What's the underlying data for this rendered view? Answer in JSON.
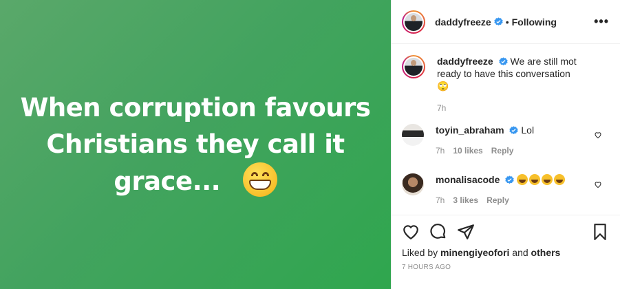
{
  "post": {
    "caption_line1": "When corruption favours",
    "caption_line2": "Christians they call it",
    "caption_line3": "grace...",
    "emoji_icon": "grinning-face-icon"
  },
  "header": {
    "username": "daddyfreeze",
    "dot": "•",
    "follow_status": "Following",
    "more_label": "•••"
  },
  "caption": {
    "username": "daddyfreeze",
    "text": "We are still mot ready to have this conversation 🙄",
    "time": "7h"
  },
  "comments": [
    {
      "username": "toyin_abraham",
      "text": "Lol",
      "time": "7h",
      "likes": "10 likes",
      "reply": "Reply"
    },
    {
      "username": "monalisacode",
      "text": "",
      "time": "7h",
      "likes": "3 likes",
      "reply": "Reply"
    }
  ],
  "footer": {
    "liked_by_prefix": "Liked by ",
    "liked_by_user": "minengiyeofori",
    "liked_by_mid": " and ",
    "liked_by_others": "others",
    "timestamp": "7 HOURS AGO"
  },
  "colors": {
    "verified": "#3897f0",
    "post_bg": "#43a35f"
  }
}
